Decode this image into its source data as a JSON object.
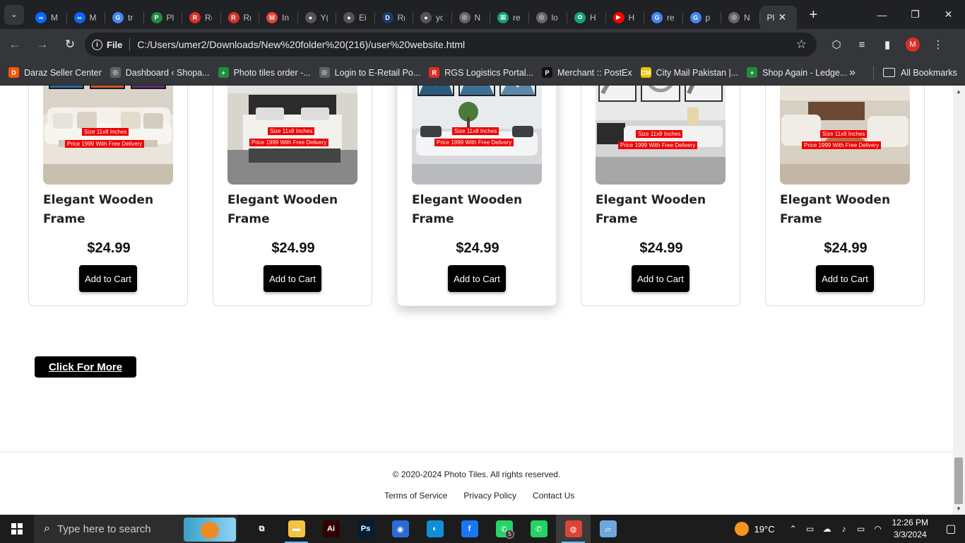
{
  "browser": {
    "tabs": [
      {
        "label": "M",
        "color": "#0866ff",
        "glyph": "∞"
      },
      {
        "label": "M",
        "color": "#0866ff",
        "glyph": "∞"
      },
      {
        "label": "tr",
        "color": "#4285f4",
        "glyph": "G"
      },
      {
        "label": "Pl",
        "color": "#1e8e3e",
        "glyph": "P"
      },
      {
        "label": "R(",
        "color": "#d93025",
        "glyph": "R"
      },
      {
        "label": "R(",
        "color": "#d93025",
        "glyph": "R"
      },
      {
        "label": "In",
        "color": "#ea4335",
        "glyph": "M"
      },
      {
        "label": "Y(",
        "color": "#555",
        "glyph": "●"
      },
      {
        "label": "Ei",
        "color": "#555",
        "glyph": "●"
      },
      {
        "label": "R(",
        "color": "#1a3e6b",
        "glyph": "D"
      },
      {
        "label": "yo",
        "color": "#555",
        "glyph": "●"
      },
      {
        "label": "N",
        "color": "#666",
        "glyph": "◎"
      },
      {
        "label": "re",
        "color": "#10a37f",
        "glyph": "▦"
      },
      {
        "label": "lo",
        "color": "#666",
        "glyph": "◎"
      },
      {
        "label": "H",
        "color": "#10a37f",
        "glyph": "✿"
      },
      {
        "label": "H",
        "color": "#ff0000",
        "glyph": "▶"
      },
      {
        "label": "re",
        "color": "#4285f4",
        "glyph": "G"
      },
      {
        "label": "p",
        "color": "#4285f4",
        "glyph": "G"
      },
      {
        "label": "N",
        "color": "#666",
        "glyph": "◎"
      }
    ],
    "active_tab": {
      "label": "Pl",
      "close": "✕"
    },
    "new_tab": "+",
    "window_controls": {
      "minimize": "—",
      "restore": "❐",
      "close": "✕"
    },
    "nav": {
      "back": "←",
      "forward": "→",
      "reload": "↻"
    },
    "address": {
      "scheme_label": "File",
      "url": "C:/Users/umer2/Downloads/New%20folder%20(216)/user%20website.html",
      "bookmark_icon": "☆"
    },
    "toolbar_icons": {
      "extensions": "⬡",
      "media": "≡",
      "sidepanel": "▮",
      "profile": "M",
      "menu": "⋮"
    },
    "bookmarks": [
      {
        "label": "Daraz Seller Center",
        "color": "#f85606",
        "glyph": "D"
      },
      {
        "label": "Dashboard ‹ Shopa...",
        "color": "#5f6368",
        "glyph": "◎"
      },
      {
        "label": "Photo tiles order -...",
        "color": "#1e8e3e",
        "glyph": "+"
      },
      {
        "label": "Login to E-Retail Po...",
        "color": "#5f6368",
        "glyph": "◎"
      },
      {
        "label": "RGS Logistics Portal...",
        "color": "#d93025",
        "glyph": "R"
      },
      {
        "label": "Merchant :: PostEx",
        "color": "#111",
        "glyph": "P"
      },
      {
        "label": "City Mail Pakistan |...",
        "color": "#f2c200",
        "glyph": "CM"
      },
      {
        "label": "Shop Again - Ledge...",
        "color": "#1e8e3e",
        "glyph": "+"
      }
    ],
    "bookmarks_more": "»",
    "all_bookmarks": "All Bookmarks"
  },
  "products": [
    {
      "name": "Elegant Wooden Frame",
      "price": "$24.99",
      "button": "Add to Cart",
      "size_tag": "Size 11x8 Inches",
      "price_tag": "Price 1999 With Free Delivery"
    },
    {
      "name": "Elegant Wooden Frame",
      "price": "$24.99",
      "button": "Add to Cart",
      "size_tag": "Size 11x8 Inches",
      "price_tag": "Price 1999 With Free Delivery"
    },
    {
      "name": "Elegant Wooden Frame",
      "price": "$24.99",
      "button": "Add to Cart",
      "size_tag": "Size 11x8 Inches",
      "price_tag": "Price 1999 With Free Delivery"
    },
    {
      "name": "Elegant Wooden Frame",
      "price": "$24.99",
      "button": "Add to Cart",
      "size_tag": "Size 11x8 Inches",
      "price_tag": "Price 1999 With Free Delivery"
    },
    {
      "name": "Elegant Wooden Frame",
      "price": "$24.99",
      "button": "Add to Cart",
      "size_tag": "Size 11x8 Inches",
      "price_tag": "Price 1999 With Free Delivery"
    }
  ],
  "more_button": "Click For More",
  "footer": {
    "copyright": "© 2020-2024 Photo Tiles. All rights reserved.",
    "links": [
      "Terms of Service",
      "Privacy Policy",
      "Contact Us"
    ]
  },
  "taskbar": {
    "search_placeholder": "Type here to search",
    "apps": [
      {
        "name": "task-view",
        "glyph": "⧉",
        "color": "transparent"
      },
      {
        "name": "file-explorer",
        "glyph": "▬",
        "color": "#f5c242"
      },
      {
        "name": "illustrator",
        "glyph": "Ai",
        "color": "#330000"
      },
      {
        "name": "photoshop",
        "glyph": "Ps",
        "color": "#001e36"
      },
      {
        "name": "firefox",
        "glyph": "◉",
        "color": "#2a6bd8"
      },
      {
        "name": "edge",
        "glyph": "◐",
        "color": "#0f8fd8"
      },
      {
        "name": "facebook",
        "glyph": "f",
        "color": "#1877f2"
      },
      {
        "name": "whatsapp",
        "glyph": "✆",
        "color": "#25d366"
      },
      {
        "name": "whatsapp-web",
        "glyph": "✆",
        "color": "#25d366"
      },
      {
        "name": "chrome",
        "glyph": "◍",
        "color": "#db4437"
      },
      {
        "name": "notepad",
        "glyph": "▱",
        "color": "#6fa8dc"
      }
    ],
    "whatsapp_badge": "5",
    "weather": "19°C",
    "time": "12:26 PM",
    "date": "3/3/2024"
  }
}
